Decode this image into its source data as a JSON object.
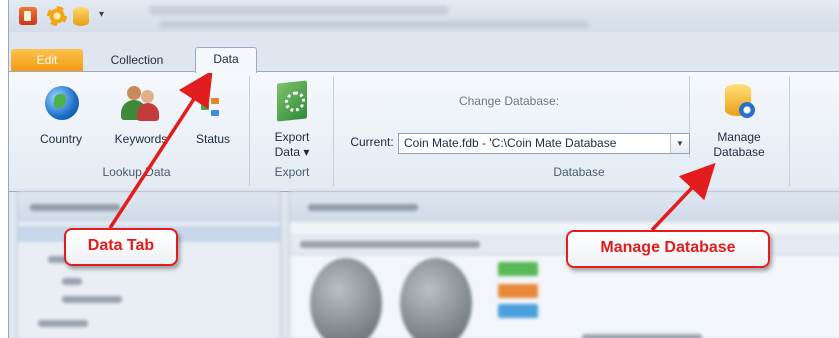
{
  "tabs": {
    "edit": "Edit",
    "collection": "Collection",
    "data": "Data"
  },
  "lookup": {
    "country": "Country",
    "keywords": "Keywords",
    "status": "Status",
    "group_label": "Lookup Data"
  },
  "export": {
    "button_line1": "Export",
    "button_line2": "Data ▾",
    "group_label": "Export"
  },
  "database": {
    "change_label": "Change Database:",
    "current_label": "Current:",
    "current_value": "Coin Mate.fdb - 'C:\\Coin Mate Database",
    "manage_line1": "Manage",
    "manage_line2": "Database",
    "group_label": "Database"
  },
  "annotations": {
    "data_tab": "Data Tab",
    "manage_database": "Manage Database"
  },
  "colors": {
    "annotation": "#e21d1d",
    "edit_tab": "#f5a623"
  }
}
